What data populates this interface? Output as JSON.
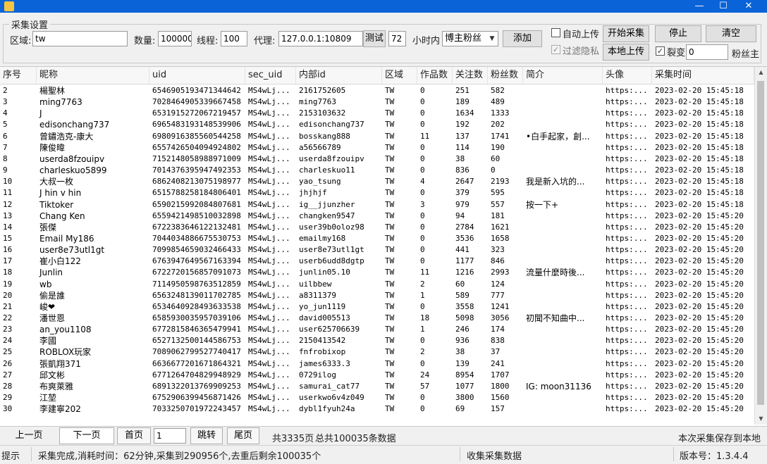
{
  "window": {
    "minimize": "—",
    "maximize": "☐",
    "close": "✕"
  },
  "settings": {
    "legend": "采集设置",
    "region_label": "区域:",
    "region_value": "tw",
    "count_label": "数量:",
    "count_value": "100000",
    "threads_label": "线程:",
    "threads_value": "100",
    "proxy_label": "代理:",
    "proxy_value": "127.0.0.1:10809",
    "test_button": "测试",
    "hours_value": "72",
    "hours_label": "小时内",
    "type_value": "博主粉丝",
    "add_button": "添加",
    "auto_upload_label": "自动上传",
    "auto_upload_checked": false,
    "filter_private_label": "过滤隐私",
    "filter_private_checked": true,
    "start_button": "开始采集",
    "local_upload_button": "本地上传",
    "stop_button": "停止",
    "clear_button": "清空",
    "fission_label": "裂变",
    "fission_checked": true,
    "fission_value": "0",
    "fission_suffix": "粉丝主"
  },
  "table": {
    "columns": [
      "序号",
      "昵称",
      "uid",
      "sec_uid",
      "内部id",
      "区域",
      "作品数",
      "关注数",
      "粉丝数",
      "简介",
      "头像",
      "采集时间"
    ],
    "rows": [
      [
        "2",
        "楊聖林",
        "6546905193471344642",
        "MS4wLj...",
        "2161752605",
        "TW",
        "0",
        "251",
        "582",
        "",
        "https:...",
        "2023-02-20 15:45:18"
      ],
      [
        "3",
        "ming7763",
        "7028464905339667458",
        "MS4wLj...",
        "ming7763",
        "TW",
        "0",
        "189",
        "489",
        "",
        "https:...",
        "2023-02-20 15:45:18"
      ],
      [
        "4",
        "J",
        "6531915272067219457",
        "MS4wLj...",
        "2153103632",
        "TW",
        "0",
        "1634",
        "1333",
        "",
        "https:...",
        "2023-02-20 15:45:18"
      ],
      [
        "5",
        "edisonchang737",
        "6965483193148539906",
        "MS4wLj...",
        "edisonchang737",
        "TW",
        "0",
        "192",
        "202",
        "",
        "https:...",
        "2023-02-20 15:45:18"
      ],
      [
        "6",
        "曾鏽浩克-康大",
        "6980916385560544258",
        "MS4wLj...",
        "bosskang888",
        "TW",
        "11",
        "137",
        "1741",
        "•白手起家，創...",
        "https:...",
        "2023-02-20 15:45:18"
      ],
      [
        "7",
        "陳俊暐",
        "6557426504094924802",
        "MS4wLj...",
        "a56566789",
        "TW",
        "0",
        "114",
        "190",
        "",
        "https:...",
        "2023-02-20 15:45:18"
      ],
      [
        "8",
        "userda8fzouipv",
        "7152148058988971009",
        "MS4wLj...",
        "userda8fzouipv",
        "TW",
        "0",
        "38",
        "60",
        "",
        "https:...",
        "2023-02-20 15:45:18"
      ],
      [
        "9",
        "charleskuo5899",
        "7014376395947492353",
        "MS4wLj...",
        "charleskuo11",
        "TW",
        "0",
        "836",
        "0",
        "",
        "https:...",
        "2023-02-20 15:45:18"
      ],
      [
        "10",
        "大叔一枚",
        "6862408213075198977",
        "MS4wLj...",
        "yao_tsung",
        "TW",
        "4",
        "2647",
        "2193",
        "我是新入坑的...",
        "https:...",
        "2023-02-20 15:45:18"
      ],
      [
        "11",
        "J hin v hin",
        "6515788258184806401",
        "MS4wLj...",
        "jhjhjf",
        "TW",
        "0",
        "379",
        "595",
        "",
        "https:...",
        "2023-02-20 15:45:18"
      ],
      [
        "12",
        "Tiktoker",
        "6590215992084807681",
        "MS4wLj...",
        "ig__jjunzher",
        "TW",
        "3",
        "979",
        "557",
        "按一下+",
        "https:...",
        "2023-02-20 15:45:18"
      ],
      [
        "13",
        "Chang Ken",
        "6559421498510032898",
        "MS4wLj...",
        "changken9547",
        "TW",
        "0",
        "94",
        "181",
        "",
        "https:...",
        "2023-02-20 15:45:20"
      ],
      [
        "14",
        "張傑",
        "6722383646122132481",
        "MS4wLj...",
        "user39b0oloz98",
        "TW",
        "0",
        "2784",
        "1621",
        "",
        "https:...",
        "2023-02-20 15:45:20"
      ],
      [
        "15",
        "Email My186",
        "7044034886675530753",
        "MS4wLj...",
        "emailmy168",
        "TW",
        "0",
        "3536",
        "1658",
        "",
        "https:...",
        "2023-02-20 15:45:20"
      ],
      [
        "16",
        "user8e73utl1gt",
        "7099854659032466433",
        "MS4wLj...",
        "user8e73utl1gt",
        "TW",
        "0",
        "441",
        "323",
        "",
        "https:...",
        "2023-02-20 15:45:20"
      ],
      [
        "17",
        "崔小白122",
        "6763947649567163394",
        "MS4wLj...",
        "userb6udd8dgtp",
        "TW",
        "0",
        "1177",
        "846",
        "",
        "https:...",
        "2023-02-20 15:45:20"
      ],
      [
        "18",
        "Junlin",
        "6722720156857091073",
        "MS4wLj...",
        "junlin05.10",
        "TW",
        "11",
        "1216",
        "2993",
        "流量什麼時後...",
        "https:...",
        "2023-02-20 15:45:20"
      ],
      [
        "19",
        "wb",
        "7114950598763512859",
        "MS4wLj...",
        "uilbbew",
        "TW",
        "2",
        "60",
        "124",
        "",
        "https:...",
        "2023-02-20 15:45:20"
      ],
      [
        "20",
        "偷是誰",
        "6563248139011702785",
        "MS4wLj...",
        "a8311379",
        "TW",
        "1",
        "589",
        "777",
        "",
        "https:...",
        "2023-02-20 15:45:20"
      ],
      [
        "21",
        "峻❤",
        "6534640928493633538",
        "MS4wLj...",
        "yo_jun1119",
        "TW",
        "0",
        "3558",
        "1241",
        "",
        "https:...",
        "2023-02-20 15:45:20"
      ],
      [
        "22",
        "潘世恩",
        "6585930035957039106",
        "MS4wLj...",
        "david005513",
        "TW",
        "18",
        "5098",
        "3056",
        "初聞不知曲中...",
        "https:...",
        "2023-02-20 15:45:20"
      ],
      [
        "23",
        "an_you1108",
        "6772815846365479941",
        "MS4wLj...",
        "user625706639",
        "TW",
        "1",
        "246",
        "174",
        "",
        "https:...",
        "2023-02-20 15:45:20"
      ],
      [
        "24",
        "李國",
        "6527132500144586753",
        "MS4wLj...",
        "2150413542",
        "TW",
        "0",
        "936",
        "838",
        "",
        "https:...",
        "2023-02-20 15:45:20"
      ],
      [
        "25",
        "ROBLOX玩家",
        "7089062799527740417",
        "MS4wLj...",
        "fnfrobixop",
        "TW",
        "2",
        "38",
        "37",
        "",
        "https:...",
        "2023-02-20 15:45:20"
      ],
      [
        "26",
        "張凱翔371",
        "6636677201671864321",
        "MS4wLj...",
        "james6333.3",
        "TW",
        "0",
        "139",
        "241",
        "",
        "https:...",
        "2023-02-20 15:45:20"
      ],
      [
        "27",
        "邱文彬",
        "6771264704829948929",
        "MS4wLj...",
        "0729ilog",
        "TW",
        "24",
        "8954",
        "1707",
        "",
        "https:...",
        "2023-02-20 15:45:20"
      ],
      [
        "28",
        "布爽萊雅",
        "6891322013769909253",
        "MS4wLj...",
        "samurai_cat77",
        "TW",
        "57",
        "1077",
        "1800",
        "IG: moon31136",
        "https:...",
        "2023-02-20 15:45:20"
      ],
      [
        "29",
        "江堃",
        "6752906399456871426",
        "MS4wLj...",
        "userkwo6v4z049",
        "TW",
        "0",
        "3800",
        "1560",
        "",
        "https:...",
        "2023-02-20 15:45:20"
      ],
      [
        "30",
        "李建寧202",
        "7033250701972243457",
        "MS4wLj...",
        "dybl1fyuh24a",
        "TW",
        "0",
        "69",
        "157",
        "",
        "https:...",
        "2023-02-20 15:45:20"
      ]
    ]
  },
  "pager": {
    "prev": "上一页",
    "next": "下一页",
    "first": "首页",
    "page_value": "1",
    "jump": "跳转",
    "last": "尾页",
    "total_pages": "共3335页",
    "total_records": "总共100035条数据",
    "save_note": "本次采集保存到本地"
  },
  "status": {
    "hint_label": "提示",
    "message": "采集完成,消耗时间：62分钟,采集到290956个,去重后剩余100035个",
    "middle": "收集采集数据",
    "version": "版本号：1.3.4.4"
  },
  "colors": {
    "titlebar": "#0a64d8"
  }
}
